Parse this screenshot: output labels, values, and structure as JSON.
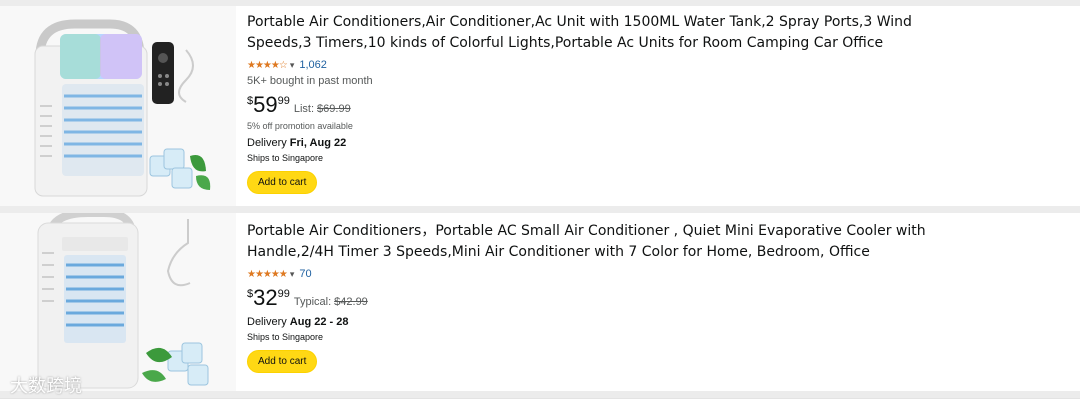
{
  "products": [
    {
      "title": "Portable Air Conditioners,Air Conditioner,Ac Unit with 1500ML Water Tank,2 Spray Ports,3 Wind Speeds,3 Timers,10 kinds of Colorful Lights,Portable Ac Units for Room Camping Car Office",
      "stars": "★★★★☆",
      "rating_count": "1,062",
      "bought": "5K+ bought in past month",
      "currency": "$",
      "price_whole": "59",
      "price_fraction": "99",
      "list_label": "List:",
      "list_price": "$69.99",
      "promo": "5% off promotion available",
      "delivery_label": "Delivery",
      "delivery_date": "Fri, Aug 22",
      "ships": "Ships to Singapore",
      "cart_label": "Add to cart"
    },
    {
      "title": "Portable Air Conditioners，Portable AC Small Air Conditioner , Quiet Mini Evaporative Cooler with Handle,2/4H Timer 3 Speeds,Mini Air Conditioner with 7 Color for Home, Bedroom, Office",
      "stars": "★★★★★",
      "rating_count": "70",
      "currency": "$",
      "price_whole": "32",
      "price_fraction": "99",
      "list_label": "Typical:",
      "list_price": "$42.99",
      "delivery_label": "Delivery",
      "delivery_date": "Aug 22 - 28",
      "ships": "Ships to Singapore",
      "cart_label": "Add to cart"
    }
  ],
  "watermark": "大数跨境",
  "colors": {
    "star": "#de7921",
    "link": "#2162a1",
    "cart_button": "#ffd814",
    "background": "#ececec"
  }
}
